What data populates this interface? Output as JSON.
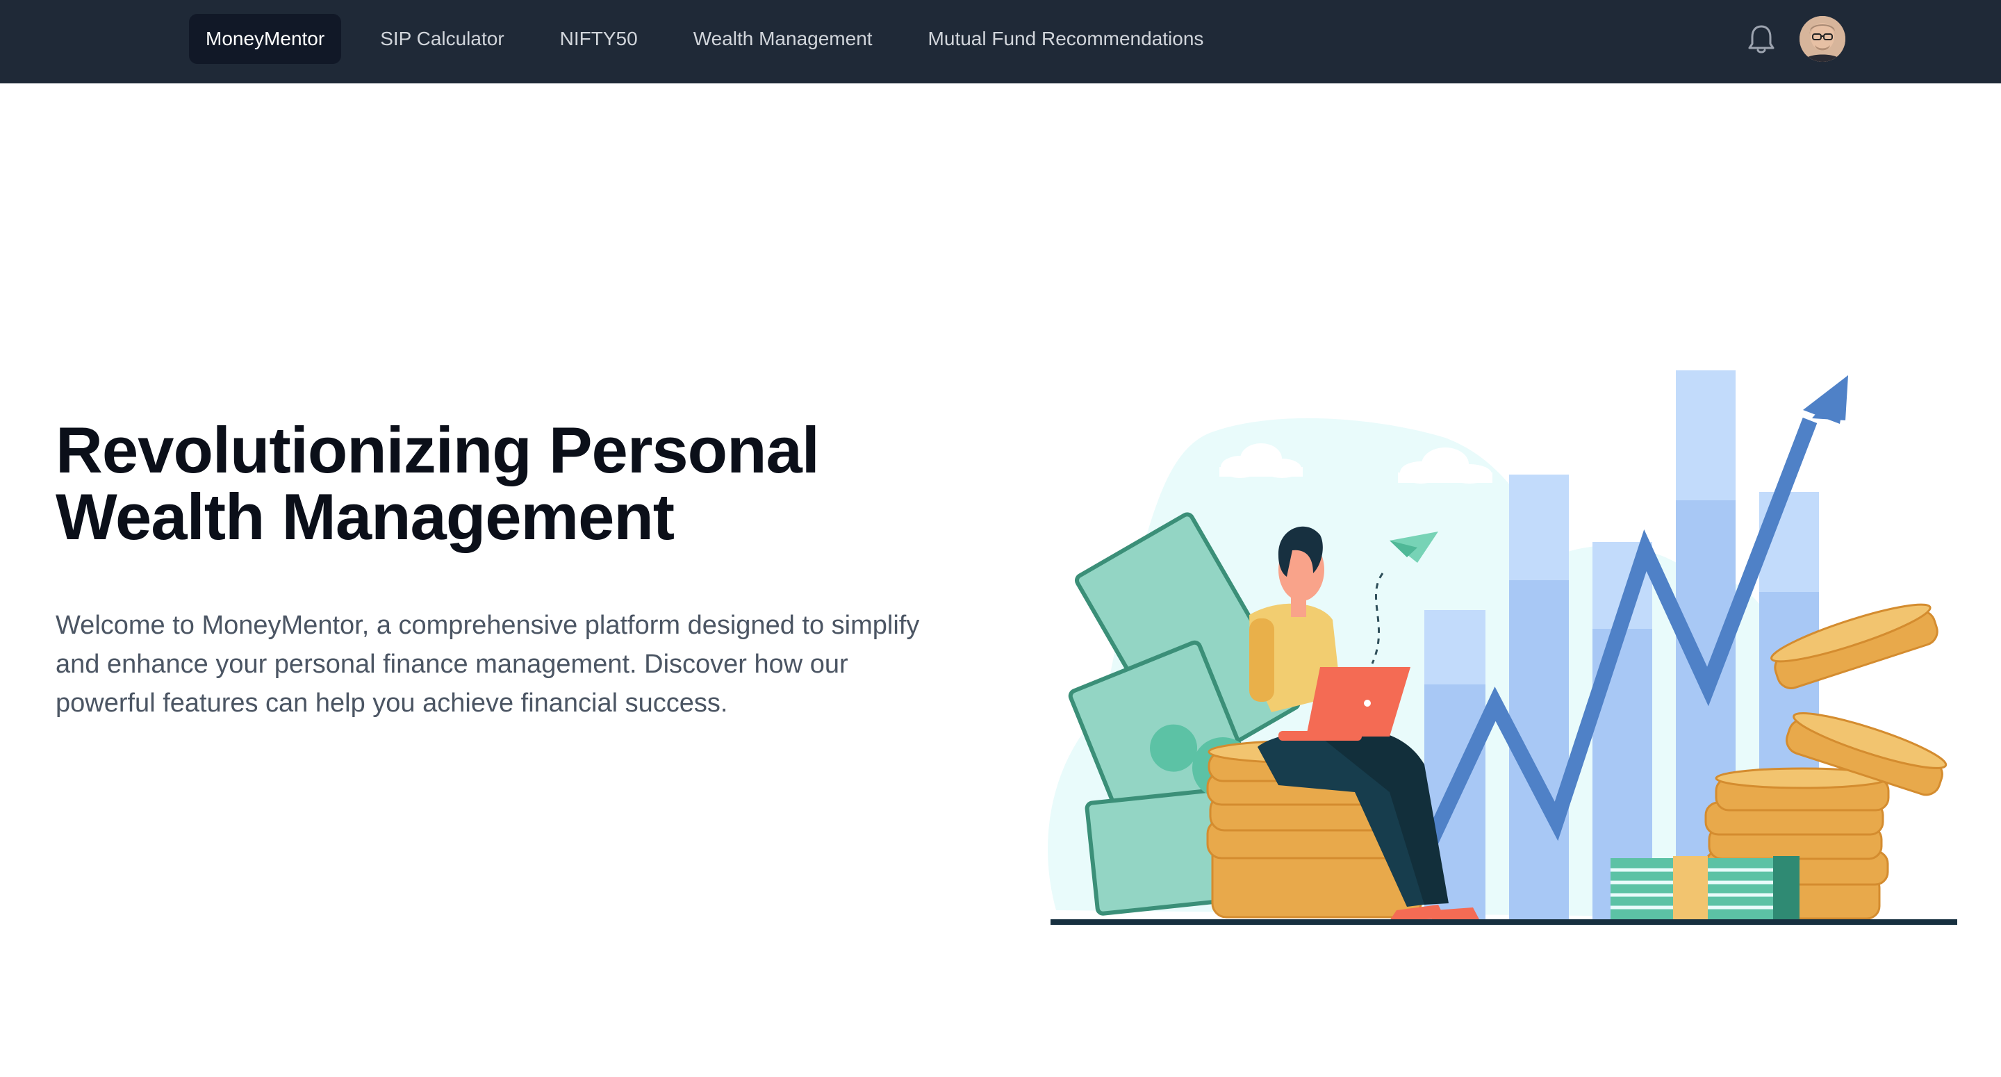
{
  "nav": {
    "items": [
      {
        "label": "MoneyMentor",
        "active": true
      },
      {
        "label": "SIP Calculator",
        "active": false
      },
      {
        "label": "NIFTY50",
        "active": false
      },
      {
        "label": "Wealth Management",
        "active": false
      },
      {
        "label": "Mutual Fund Recommendations",
        "active": false
      }
    ],
    "notification_icon": "bell-icon",
    "avatar_icon": "user-avatar"
  },
  "hero": {
    "title_line1": "Revolutionizing Personal",
    "title_line2": "Wealth Management",
    "description": "Welcome to MoneyMentor, a comprehensive platform designed to simplify and enhance your personal finance management. Discover how our powerful features can help you achieve financial success."
  },
  "colors": {
    "navbar_bg": "#1f2937",
    "active_tab_bg": "#111827",
    "chart_blue": "#4f81c7",
    "coin_gold": "#e8a94b",
    "cash_green": "#93d5c4"
  }
}
